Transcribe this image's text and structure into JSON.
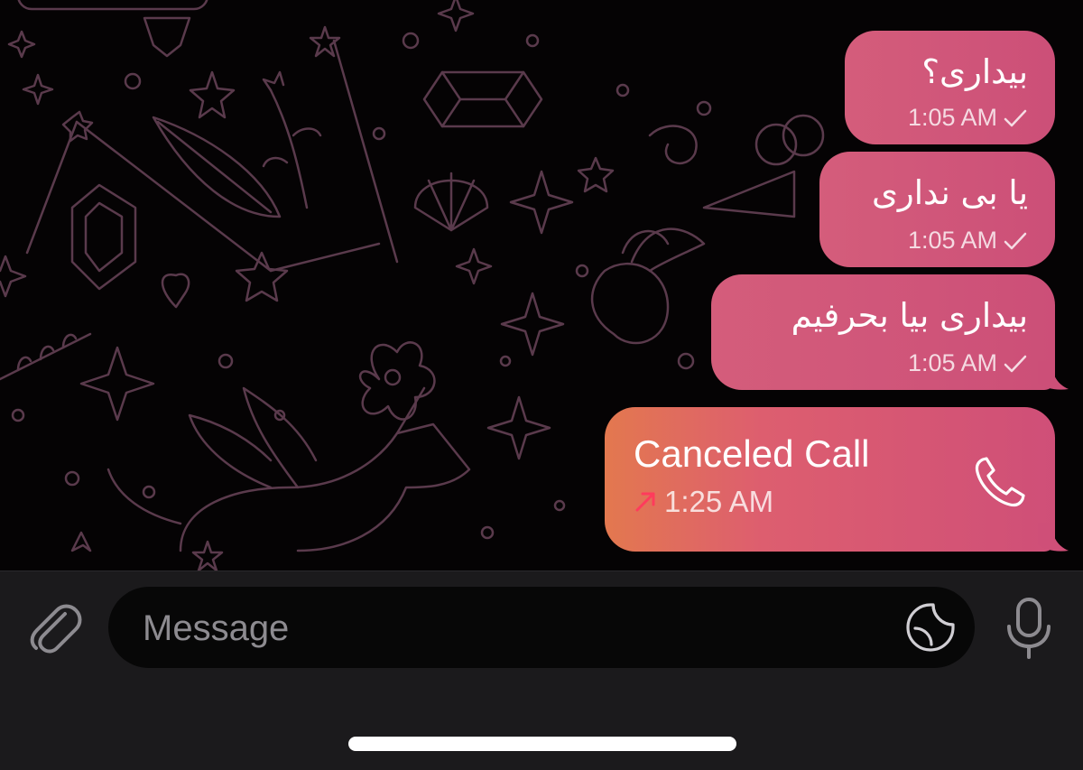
{
  "messages": [
    {
      "text": "بیداری؟",
      "time": "1:05 AM",
      "status_icon": "single-check-icon"
    },
    {
      "text": "یا بی نداری",
      "time": "1:05 AM",
      "status_icon": "single-check-icon"
    },
    {
      "text": "بیداری بیا بحرفیم",
      "time": "1:05 AM",
      "status_icon": "single-check-icon"
    }
  ],
  "call": {
    "title": "Canceled Call",
    "time": "1:25 AM",
    "direction_icon": "outgoing-arrow-icon",
    "action_icon": "phone-icon"
  },
  "composer": {
    "placeholder": "Message",
    "attach_icon": "paperclip-icon",
    "sticker_icon": "sticker-icon",
    "mic_icon": "microphone-icon"
  },
  "colors": {
    "bubble": "#d45d7b",
    "call_gradient_start": "#e3784f",
    "wallpaper_line": "#5a3a4c",
    "input_bar": "#1b1a1c",
    "missed_arrow": "#ff3b5c"
  }
}
